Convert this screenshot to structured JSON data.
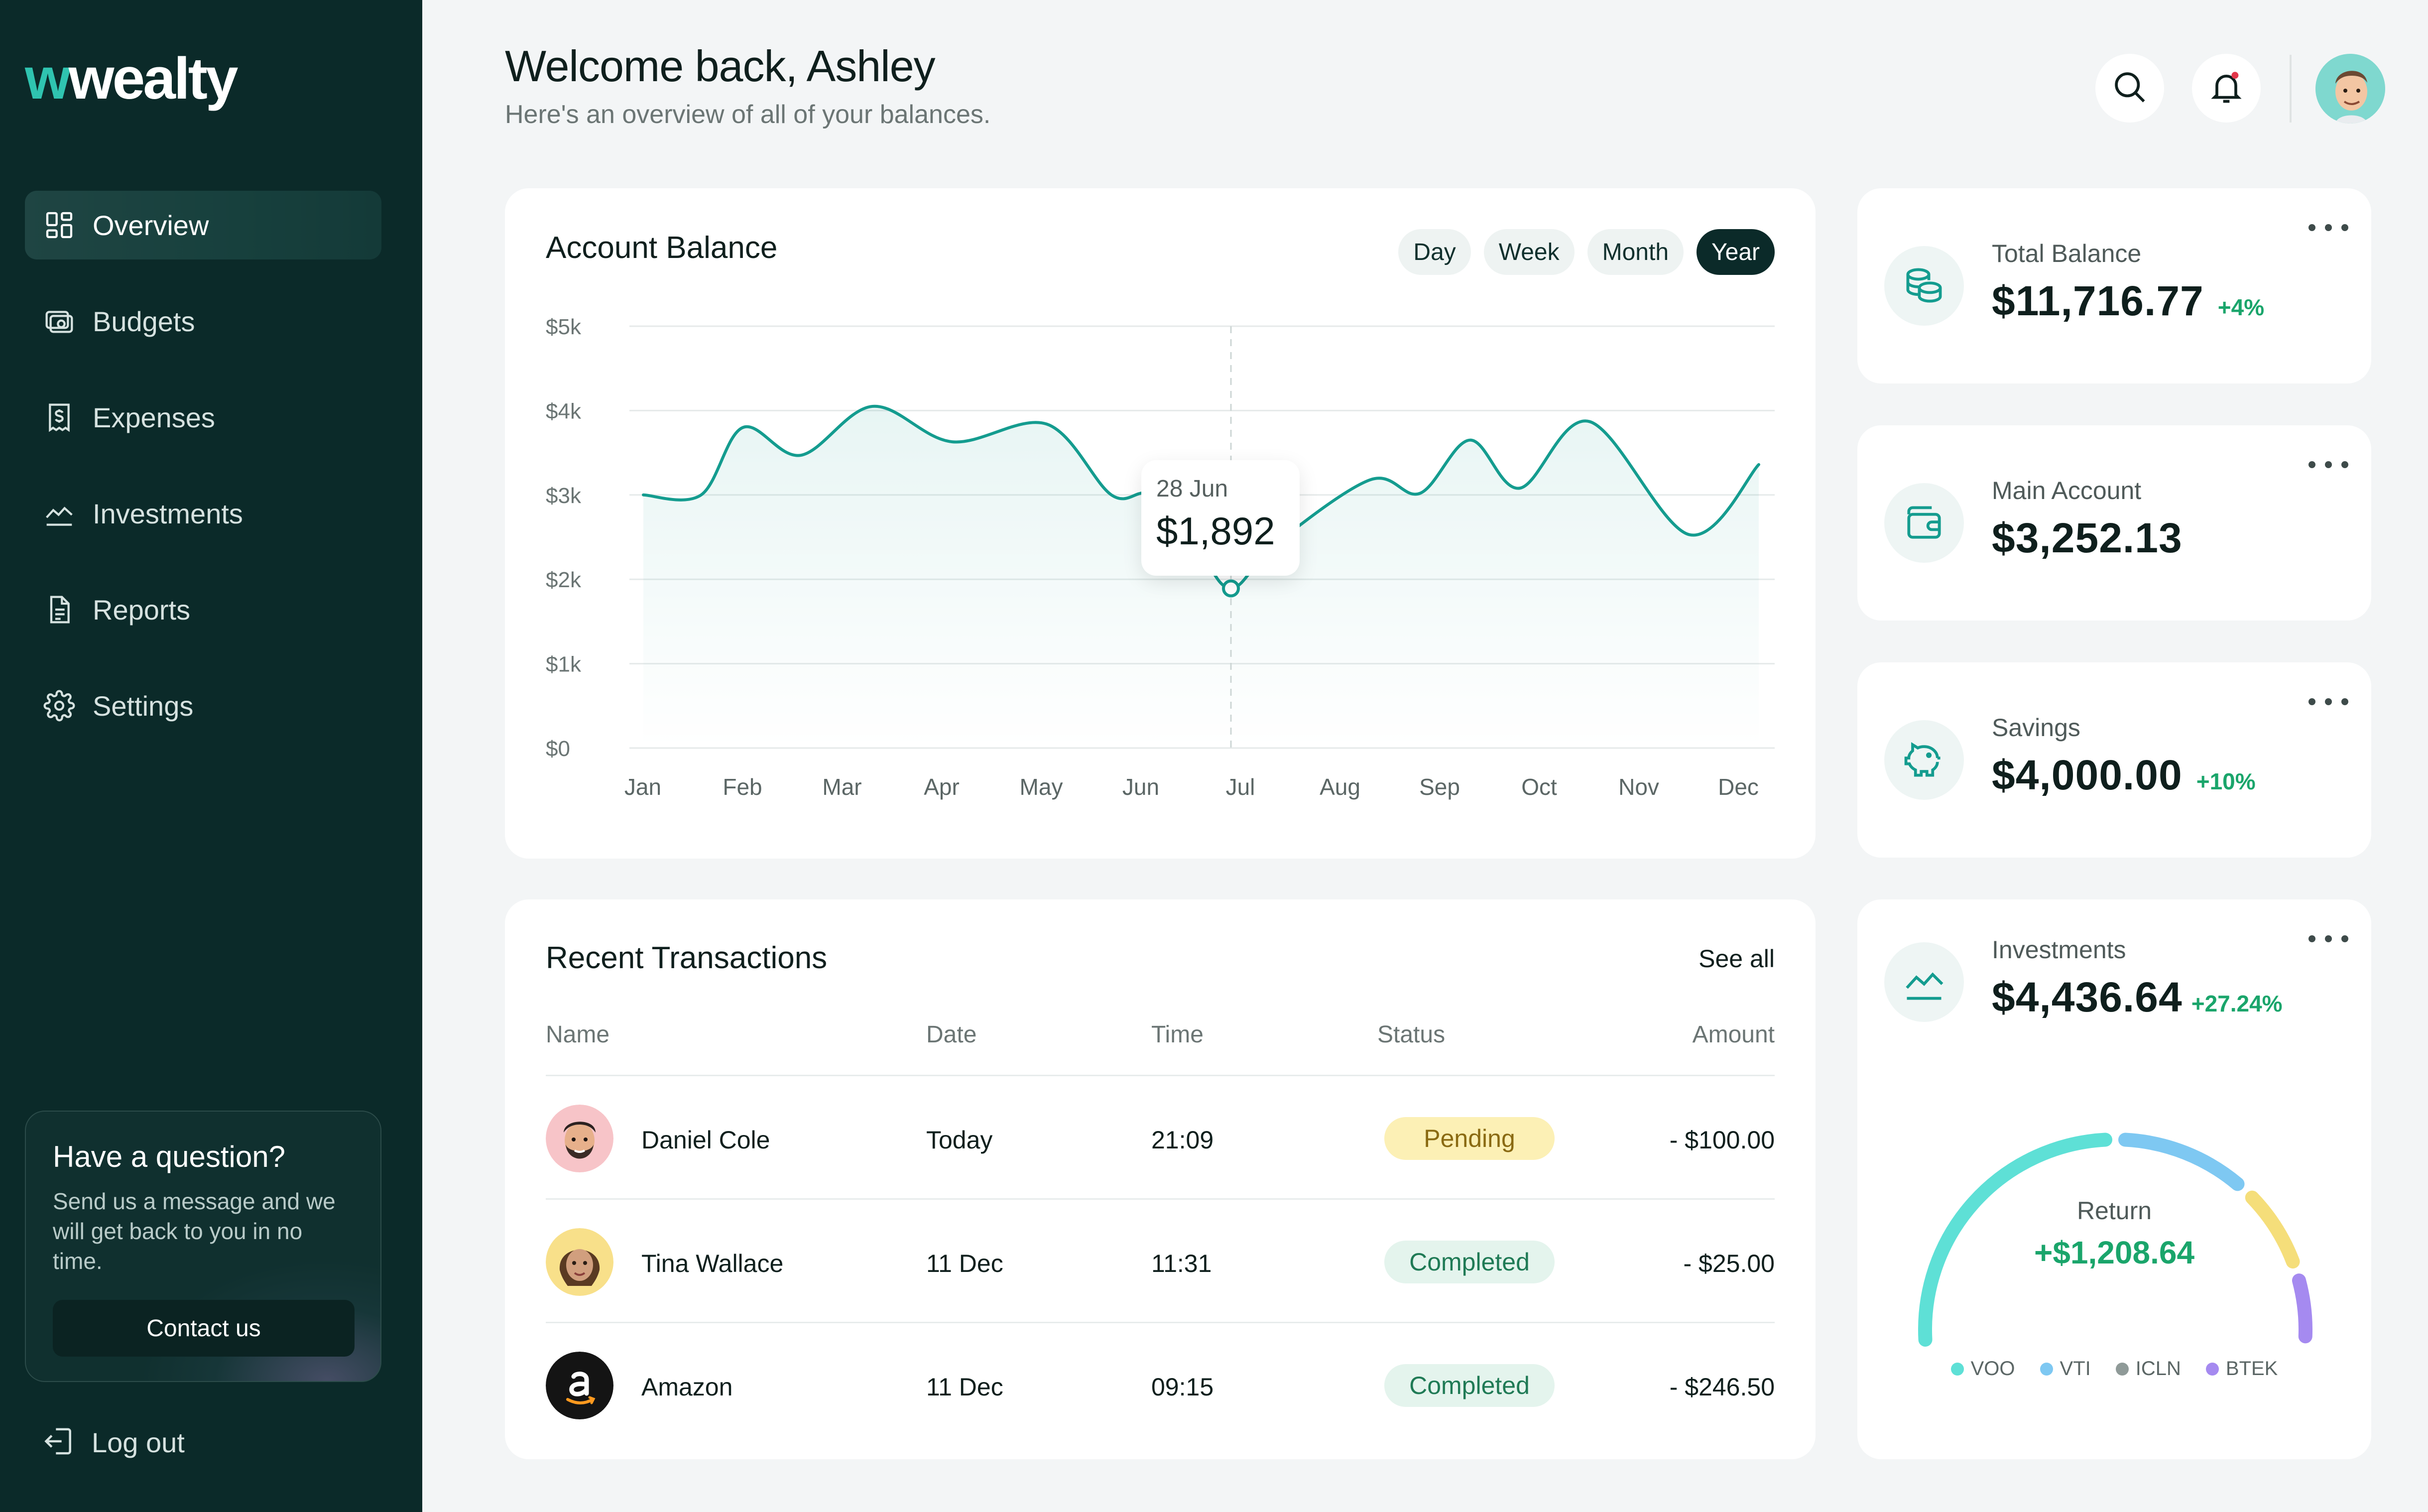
{
  "brand": {
    "logo_accent": "w",
    "logo_text": "wealty"
  },
  "sidebar": {
    "items": [
      {
        "label": "Overview",
        "icon": "grid-icon",
        "active": true
      },
      {
        "label": "Budgets",
        "icon": "wallet-money-icon"
      },
      {
        "label": "Expenses",
        "icon": "receipt-dollar-icon"
      },
      {
        "label": "Investments",
        "icon": "trend-chart-icon"
      },
      {
        "label": "Reports",
        "icon": "document-icon"
      },
      {
        "label": "Settings",
        "icon": "gear-icon"
      }
    ],
    "question": {
      "title": "Have a question?",
      "text": "Send us a message and we will get back to you in no time.",
      "button": "Contact us"
    },
    "logout": "Log out"
  },
  "header": {
    "title": "Welcome back, Ashley",
    "subtitle": "Here's an overview of all of your balances."
  },
  "balance": {
    "title": "Account Balance",
    "periods": [
      "Day",
      "Week",
      "Month",
      "Year"
    ],
    "active_period": "Year",
    "tooltip": {
      "date": "28 Jun",
      "value": "$1,892"
    }
  },
  "chart_data": {
    "type": "area",
    "title": "Account Balance",
    "x_labels": [
      "Jan",
      "Feb",
      "Mar",
      "Apr",
      "May",
      "Jun",
      "Jul",
      "Aug",
      "Sep",
      "Oct",
      "Nov",
      "Dec"
    ],
    "y_ticks": [
      "$0",
      "$1k",
      "$2k",
      "$3k",
      "$4k",
      "$5k"
    ],
    "ylim": [
      0,
      5000
    ],
    "grid": true,
    "highlight": {
      "date": "28 Jun",
      "value": 1892
    },
    "series": [
      {
        "points": [
          {
            "x": 0.0,
            "y": 3000
          },
          {
            "x": 0.58,
            "y": 3000
          },
          {
            "x": 1.0,
            "y": 3800
          },
          {
            "x": 1.58,
            "y": 3470
          },
          {
            "x": 2.3,
            "y": 4050
          },
          {
            "x": 3.1,
            "y": 3630
          },
          {
            "x": 4.05,
            "y": 3840
          },
          {
            "x": 4.7,
            "y": 3000
          },
          {
            "x": 5.1,
            "y": 3000
          },
          {
            "x": 5.55,
            "y": 2400
          },
          {
            "x": 5.9,
            "y": 1892
          },
          {
            "x": 6.35,
            "y": 2420
          },
          {
            "x": 7.3,
            "y": 3180
          },
          {
            "x": 7.8,
            "y": 3020
          },
          {
            "x": 8.3,
            "y": 3650
          },
          {
            "x": 8.8,
            "y": 3080
          },
          {
            "x": 9.5,
            "y": 3870
          },
          {
            "x": 10.5,
            "y": 2530
          },
          {
            "x": 11.2,
            "y": 3360
          }
        ]
      }
    ]
  },
  "transactions": {
    "title": "Recent Transactions",
    "see_all": "See all",
    "columns": [
      "Name",
      "Date",
      "Time",
      "Status",
      "Amount"
    ],
    "rows": [
      {
        "name": "Daniel Cole",
        "date": "Today",
        "time": "21:09",
        "status": "Pending",
        "amount": "- $100.00"
      },
      {
        "name": "Tina Wallace",
        "date": "11 Dec",
        "time": "11:31",
        "status": "Completed",
        "amount": "- $25.00"
      },
      {
        "name": "Amazon",
        "date": "11 Dec",
        "time": "09:15",
        "status": "Completed",
        "amount": "- $246.50"
      }
    ]
  },
  "stats": {
    "total": {
      "label": "Total Balance",
      "value": "$11,716.77",
      "change": "+4%",
      "icon": "coins-icon"
    },
    "main": {
      "label": "Main Account",
      "value": "$3,252.13",
      "icon": "wallet-icon"
    },
    "savings": {
      "label": "Savings",
      "value": "$4,000.00",
      "change": "+10%",
      "icon": "piggy-bank-icon"
    },
    "investments": {
      "label": "Investments",
      "value": "$4,436.64",
      "change": "+27.24%",
      "icon": "trend-up-icon"
    }
  },
  "portfolio": {
    "return_label": "Return",
    "return_value": "+$1,208.64",
    "legend": [
      {
        "name": "VOO",
        "color": "#5ee0d6"
      },
      {
        "name": "VTI",
        "color": "#7ec8f2"
      },
      {
        "name": "ICLN",
        "color": "#8f9a98"
      },
      {
        "name": "BTEK",
        "color": "#a58af0"
      }
    ],
    "arc_colors": [
      "#5ee0d6",
      "#7ec8f2",
      "#f5de7a",
      "#a58af0"
    ]
  },
  "colors": {
    "sidebar": "#0b2a29",
    "accent": "#149c8f",
    "positive": "#1aa56b"
  }
}
